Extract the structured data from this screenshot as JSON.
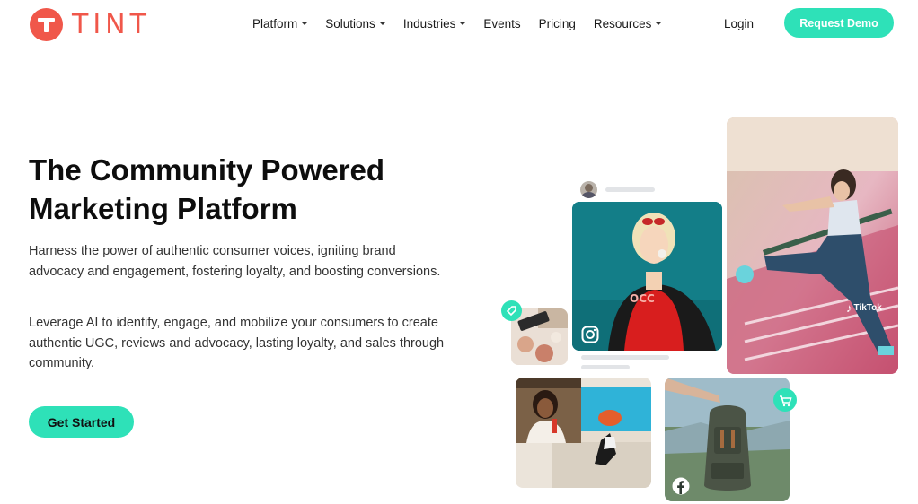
{
  "header": {
    "logo_text": "TINT",
    "nav": [
      {
        "label": "Platform",
        "has_dropdown": true
      },
      {
        "label": "Solutions",
        "has_dropdown": true
      },
      {
        "label": "Industries",
        "has_dropdown": true
      },
      {
        "label": "Events",
        "has_dropdown": false
      },
      {
        "label": "Pricing",
        "has_dropdown": false
      },
      {
        "label": "Resources",
        "has_dropdown": true
      }
    ],
    "login_label": "Login",
    "demo_label": "Request Demo"
  },
  "hero": {
    "title": "The Community Powered Marketing Platform",
    "paragraph1": "Harness the power of authentic consumer voices, igniting brand advocacy and engagement, fostering loyalty, and boosting conversions.",
    "paragraph2": "Leverage AI to identify, engage, and mobilize your consumers to create authentic UGC, reviews and advocacy, lasting loyalty, and sales through community.",
    "cta_label": "Get Started"
  },
  "collage": {
    "tiktok_label": "TikTok",
    "icons": [
      "instagram-icon",
      "tiktok-icon",
      "facebook-icon",
      "cart-icon",
      "tag-icon"
    ]
  },
  "colors": {
    "brand": "#f0574a",
    "accent": "#2ee1b8"
  }
}
